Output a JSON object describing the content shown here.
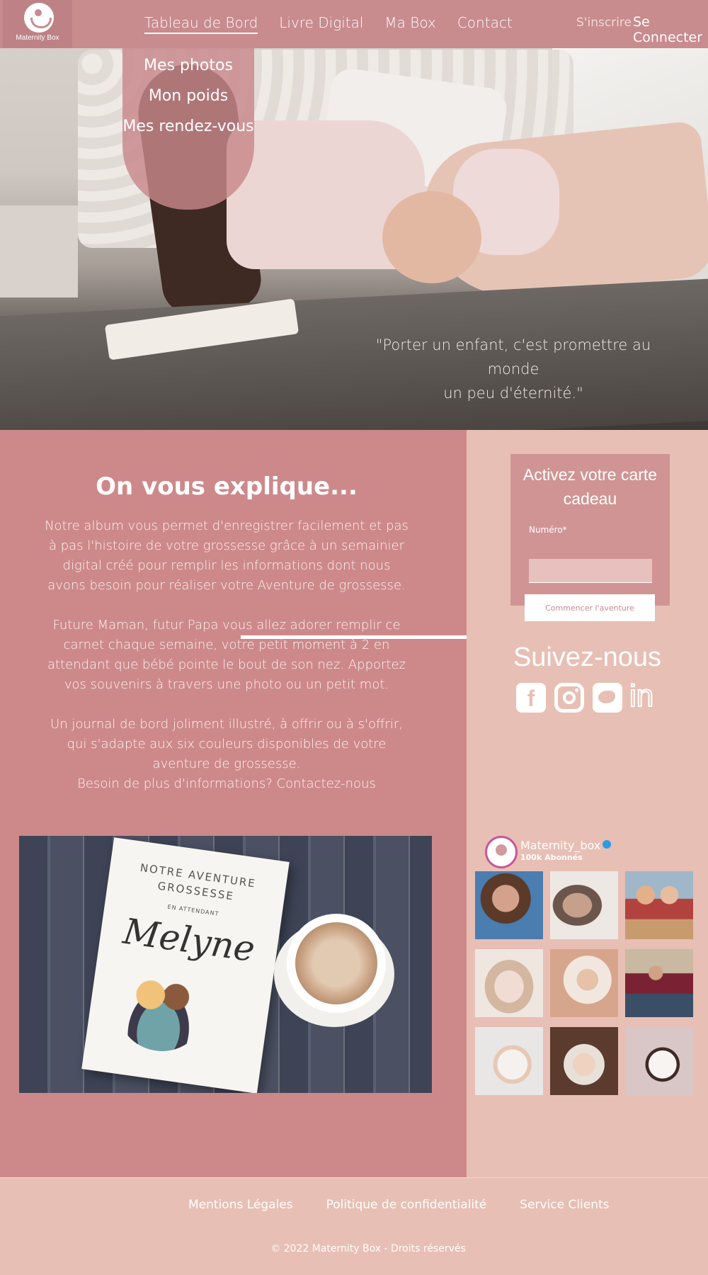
{
  "header": {
    "logo_text": "Maternity Box",
    "nav": [
      {
        "label": "Tableau de Bord"
      },
      {
        "label": "Livre Digital"
      },
      {
        "label": "Ma Box"
      },
      {
        "label": "Contact"
      }
    ],
    "signup_label": "S'inscrire",
    "login_label": "Se Connecter"
  },
  "dropdown": {
    "items": [
      {
        "label": "Mes photos"
      },
      {
        "label": "Mon poids"
      },
      {
        "label": "Mes rendez-vous"
      }
    ]
  },
  "hero": {
    "quote_line1": "\"Porter un enfant, c'est promettre au monde",
    "quote_line2": "un peu d'éternité.\""
  },
  "explain": {
    "title": "On vous explique...",
    "paragraph1": "Notre album vous permet d'enregistrer facilement et pas à pas l'histoire de votre grossesse grâce à un semainier digital créé pour remplir les informations dont nous avons besoin pour réaliser votre Aventure de grossesse.",
    "paragraph2": "Future Maman, futur Papa vous allez adorer remplir ce carnet chaque semaine, votre petit moment à 2 en attendant que bébé pointe le bout de son nez. Apportez vos souvenirs à travers une photo ou un petit mot.",
    "paragraph3": "Un journal de bord joliment illustré, à offrir ou à s'offrir, qui s'adapte aux six couleurs disponibles de votre aventure de grossesse.",
    "contact_line": "Besoin de plus d'informations? Contactez-nous"
  },
  "product_image": {
    "line1": "NOTRE AVENTURE",
    "line2": "GROSSESSE",
    "line3": "EN ATTENDANT",
    "name": "Melyne"
  },
  "gift_card": {
    "title": "Activez votre carte cadeau",
    "number_label": "Numéro*",
    "number_value": "",
    "button_label": "Commencer l'aventure"
  },
  "follow": {
    "title": "Suivez-nous",
    "icons": [
      "facebook-icon",
      "instagram-icon",
      "twitter-icon",
      "linkedin-icon"
    ]
  },
  "instagram": {
    "username": "Maternity_box",
    "followers": "100k  Abonnés",
    "photos": [
      "bearded-man",
      "sleeping-couple",
      "family-reading",
      "newborn-basket",
      "baby-flatlay",
      "pregnant-couple-autumn",
      "pregnant-woman-bed",
      "father-newborn",
      "pregnant-woman-white-dress"
    ]
  },
  "footer": {
    "links": [
      {
        "label": "Mentions Légales"
      },
      {
        "label": "Politique de confidentialité"
      },
      {
        "label": "Service Clients"
      }
    ],
    "copyright": "© 2022 Maternity Box - Droits réservés"
  },
  "colors": {
    "header": "#c88b8e",
    "content_left": "#cd898a",
    "content_right": "#e8bfb4",
    "gift_card": "#d09494",
    "text": "#ffffff"
  }
}
